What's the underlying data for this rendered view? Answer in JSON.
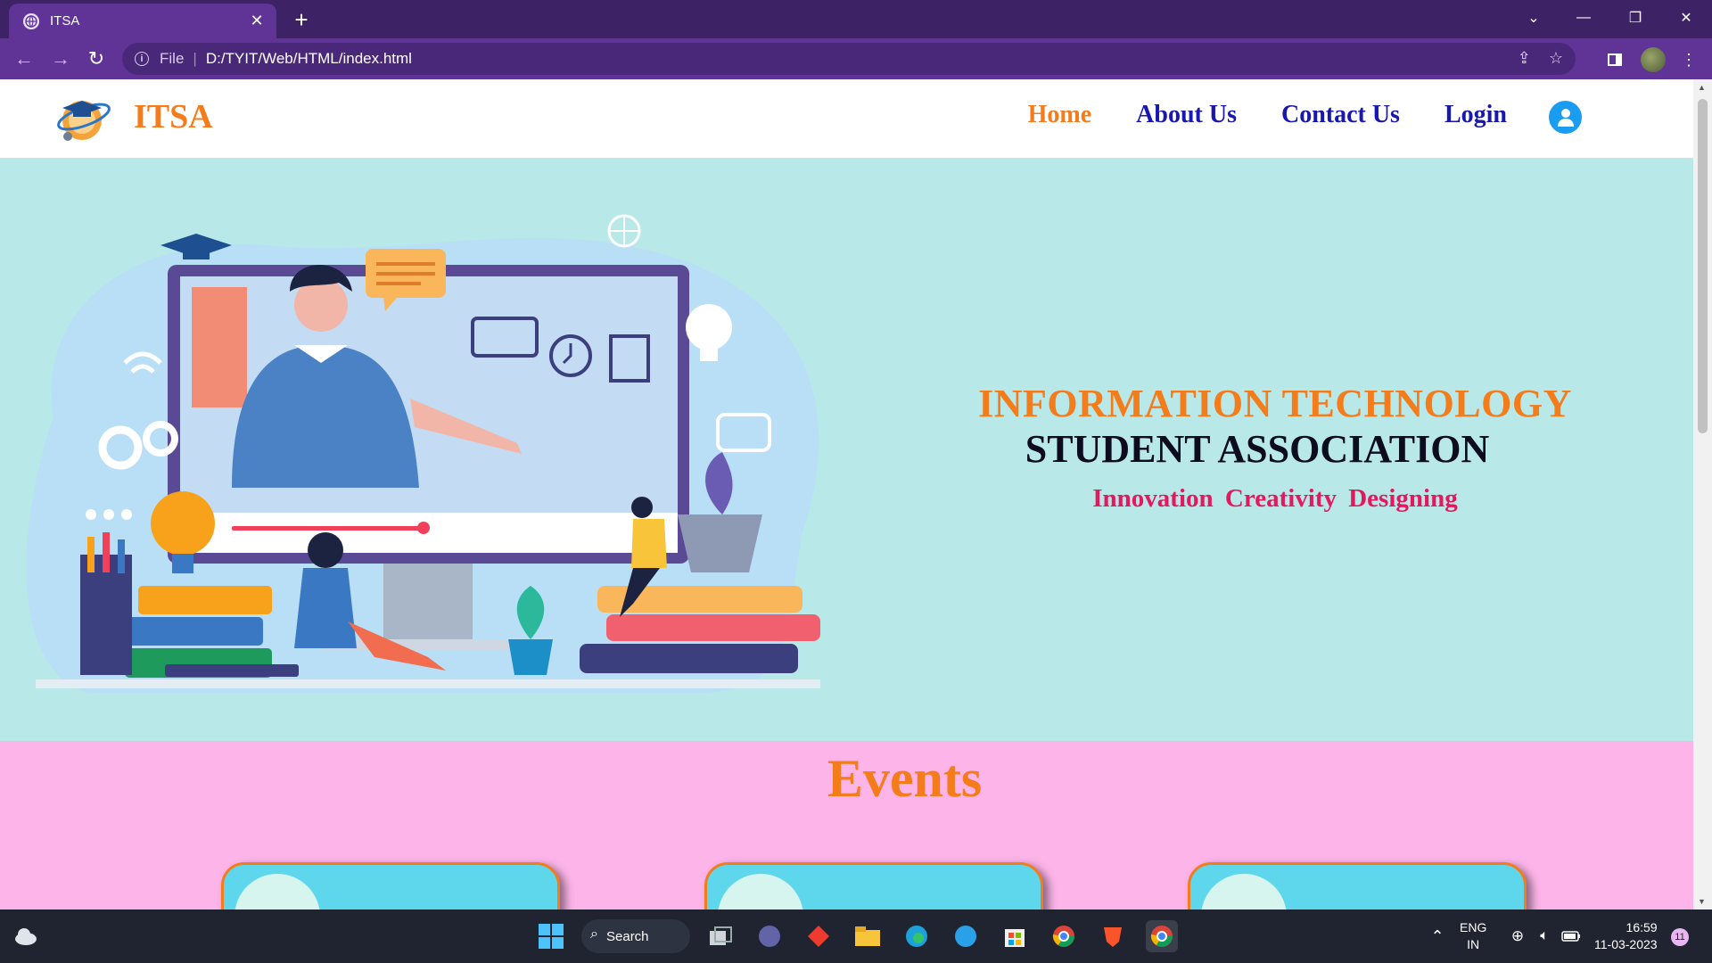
{
  "browser": {
    "tab_title": "ITSA",
    "tab_close": "✕",
    "new_tab": "+",
    "url_scheme": "File",
    "url_separator": "|",
    "url": "D:/TYIT/Web/HTML/index.html"
  },
  "site": {
    "brand": "ITSA",
    "nav": {
      "home": "Home",
      "about": "About Us",
      "contact": "Contact Us",
      "login": "Login"
    }
  },
  "hero": {
    "line1": "INFORMATION TECHNOLOGY",
    "line2": "STUDENT ASSOCIATION",
    "tagline": "Innovation  Creativity  Designing"
  },
  "events": {
    "title": "Events"
  },
  "taskbar": {
    "search_label": "Search",
    "lang_top": "ENG",
    "lang_bottom": "IN",
    "time": "16:59",
    "date": "11-03-2023",
    "notification_count": "11"
  },
  "colors": {
    "browser_frame": "#3d2266",
    "browser_toolbar": "#5f3496",
    "brand_orange": "#f47c1b",
    "nav_blue": "#1818b0",
    "hero_bg": "#b9e8e8",
    "events_bg": "#fdb5e9",
    "card_bg": "#5ed7ec",
    "tagline_pink": "#e5175d"
  }
}
